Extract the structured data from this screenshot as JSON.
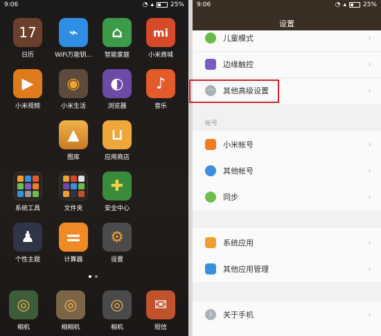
{
  "home": {
    "status": {
      "time": "9:06",
      "battery": "25%"
    },
    "apps": [
      {
        "label": "日历",
        "glyph": "17",
        "icon": "calendar-icon",
        "color": "#6b3f2e"
      },
      {
        "label": "WiFi万能钥...",
        "glyph": "⌁",
        "icon": "wifi-key-icon",
        "color": "#2f8de4"
      },
      {
        "label": "智能家庭",
        "glyph": "⌂",
        "icon": "smart-home-icon",
        "color": "#3b9b49"
      },
      {
        "label": "小米商城",
        "glyph": "mi",
        "icon": "mi-store-icon",
        "color": "#d64a2a"
      },
      {
        "label": "小米视频",
        "glyph": "▶",
        "icon": "video-icon",
        "color": "#e07b1c"
      },
      {
        "label": "小米生活",
        "glyph": "◉",
        "icon": "mi-life-icon",
        "color": "#5c4a3c"
      },
      {
        "label": "浏览器",
        "glyph": "◐",
        "icon": "browser-icon",
        "color": "#6b4aa8"
      },
      {
        "label": "音乐",
        "glyph": "♪",
        "icon": "music-icon",
        "color": "#e35a2b"
      },
      {
        "label": "图库",
        "glyph": "▲",
        "icon": "gallery-icon",
        "color": "#e8a23a"
      },
      {
        "label": "应用商店",
        "glyph": "⊔",
        "icon": "app-store-icon",
        "color": "#f0a73a"
      },
      {
        "label": "系统工具",
        "glyph": "",
        "icon": "system-tools-folder-icon",
        "color": "#2a2622"
      },
      {
        "label": "文件夹",
        "glyph": "",
        "icon": "folder-icon",
        "color": "#2a2622"
      },
      {
        "label": "安全中心",
        "glyph": "✚",
        "icon": "security-center-icon",
        "color": "#3a8c3c"
      },
      {
        "label": "个性主题",
        "glyph": "♟",
        "icon": "themes-icon",
        "color": "#2f3446"
      },
      {
        "label": "计算器",
        "glyph": "=",
        "icon": "calculator-icon",
        "color": "#f08a25"
      },
      {
        "label": "设置",
        "glyph": "⚙",
        "icon": "settings-icon",
        "color": "#4b4b4b"
      }
    ],
    "dock": [
      {
        "label": "相机",
        "glyph": "◎",
        "icon": "camera-icon",
        "color": "#3f5c3a"
      },
      {
        "label": "相相机",
        "glyph": "◎",
        "icon": "camera-icon",
        "color": "#7b6547"
      },
      {
        "label": "相机",
        "glyph": "◎",
        "icon": "camera-icon",
        "color": "#4a4a4a"
      },
      {
        "label": "短信",
        "glyph": "✉",
        "icon": "sms-icon",
        "color": "#c0532c"
      }
    ]
  },
  "settings": {
    "status": {
      "time": "9:06",
      "battery": "25%"
    },
    "title": "设置",
    "rows": [
      {
        "label": "儿童模式",
        "icon": "child-mode-icon",
        "color": "#6aba4a",
        "glyph": ""
      },
      {
        "label": "边缘触控",
        "icon": "edge-touch-icon",
        "color": "#7a5bc2",
        "glyph": ""
      },
      {
        "label": "其他高级设置",
        "icon": "more-settings-icon",
        "color": "#a9b3bd",
        "glyph": "···"
      },
      {
        "label": "小米帐号",
        "icon": "mi-account-icon",
        "color": "#f07c1f",
        "glyph": ""
      },
      {
        "label": "其他帐号",
        "icon": "other-accounts-icon",
        "color": "#3a8fe0",
        "glyph": ""
      },
      {
        "label": "同步",
        "icon": "sync-icon",
        "color": "#6fbd4f",
        "glyph": ""
      },
      {
        "label": "系统应用",
        "icon": "system-apps-icon",
        "color": "#f0a033",
        "glyph": ""
      },
      {
        "label": "其他应用管理",
        "icon": "app-management-icon",
        "color": "#3a8fe0",
        "glyph": ""
      },
      {
        "label": "关于手机",
        "icon": "about-phone-icon",
        "color": "#a9b3bd",
        "glyph": ""
      }
    ],
    "section_label": "帐号"
  }
}
